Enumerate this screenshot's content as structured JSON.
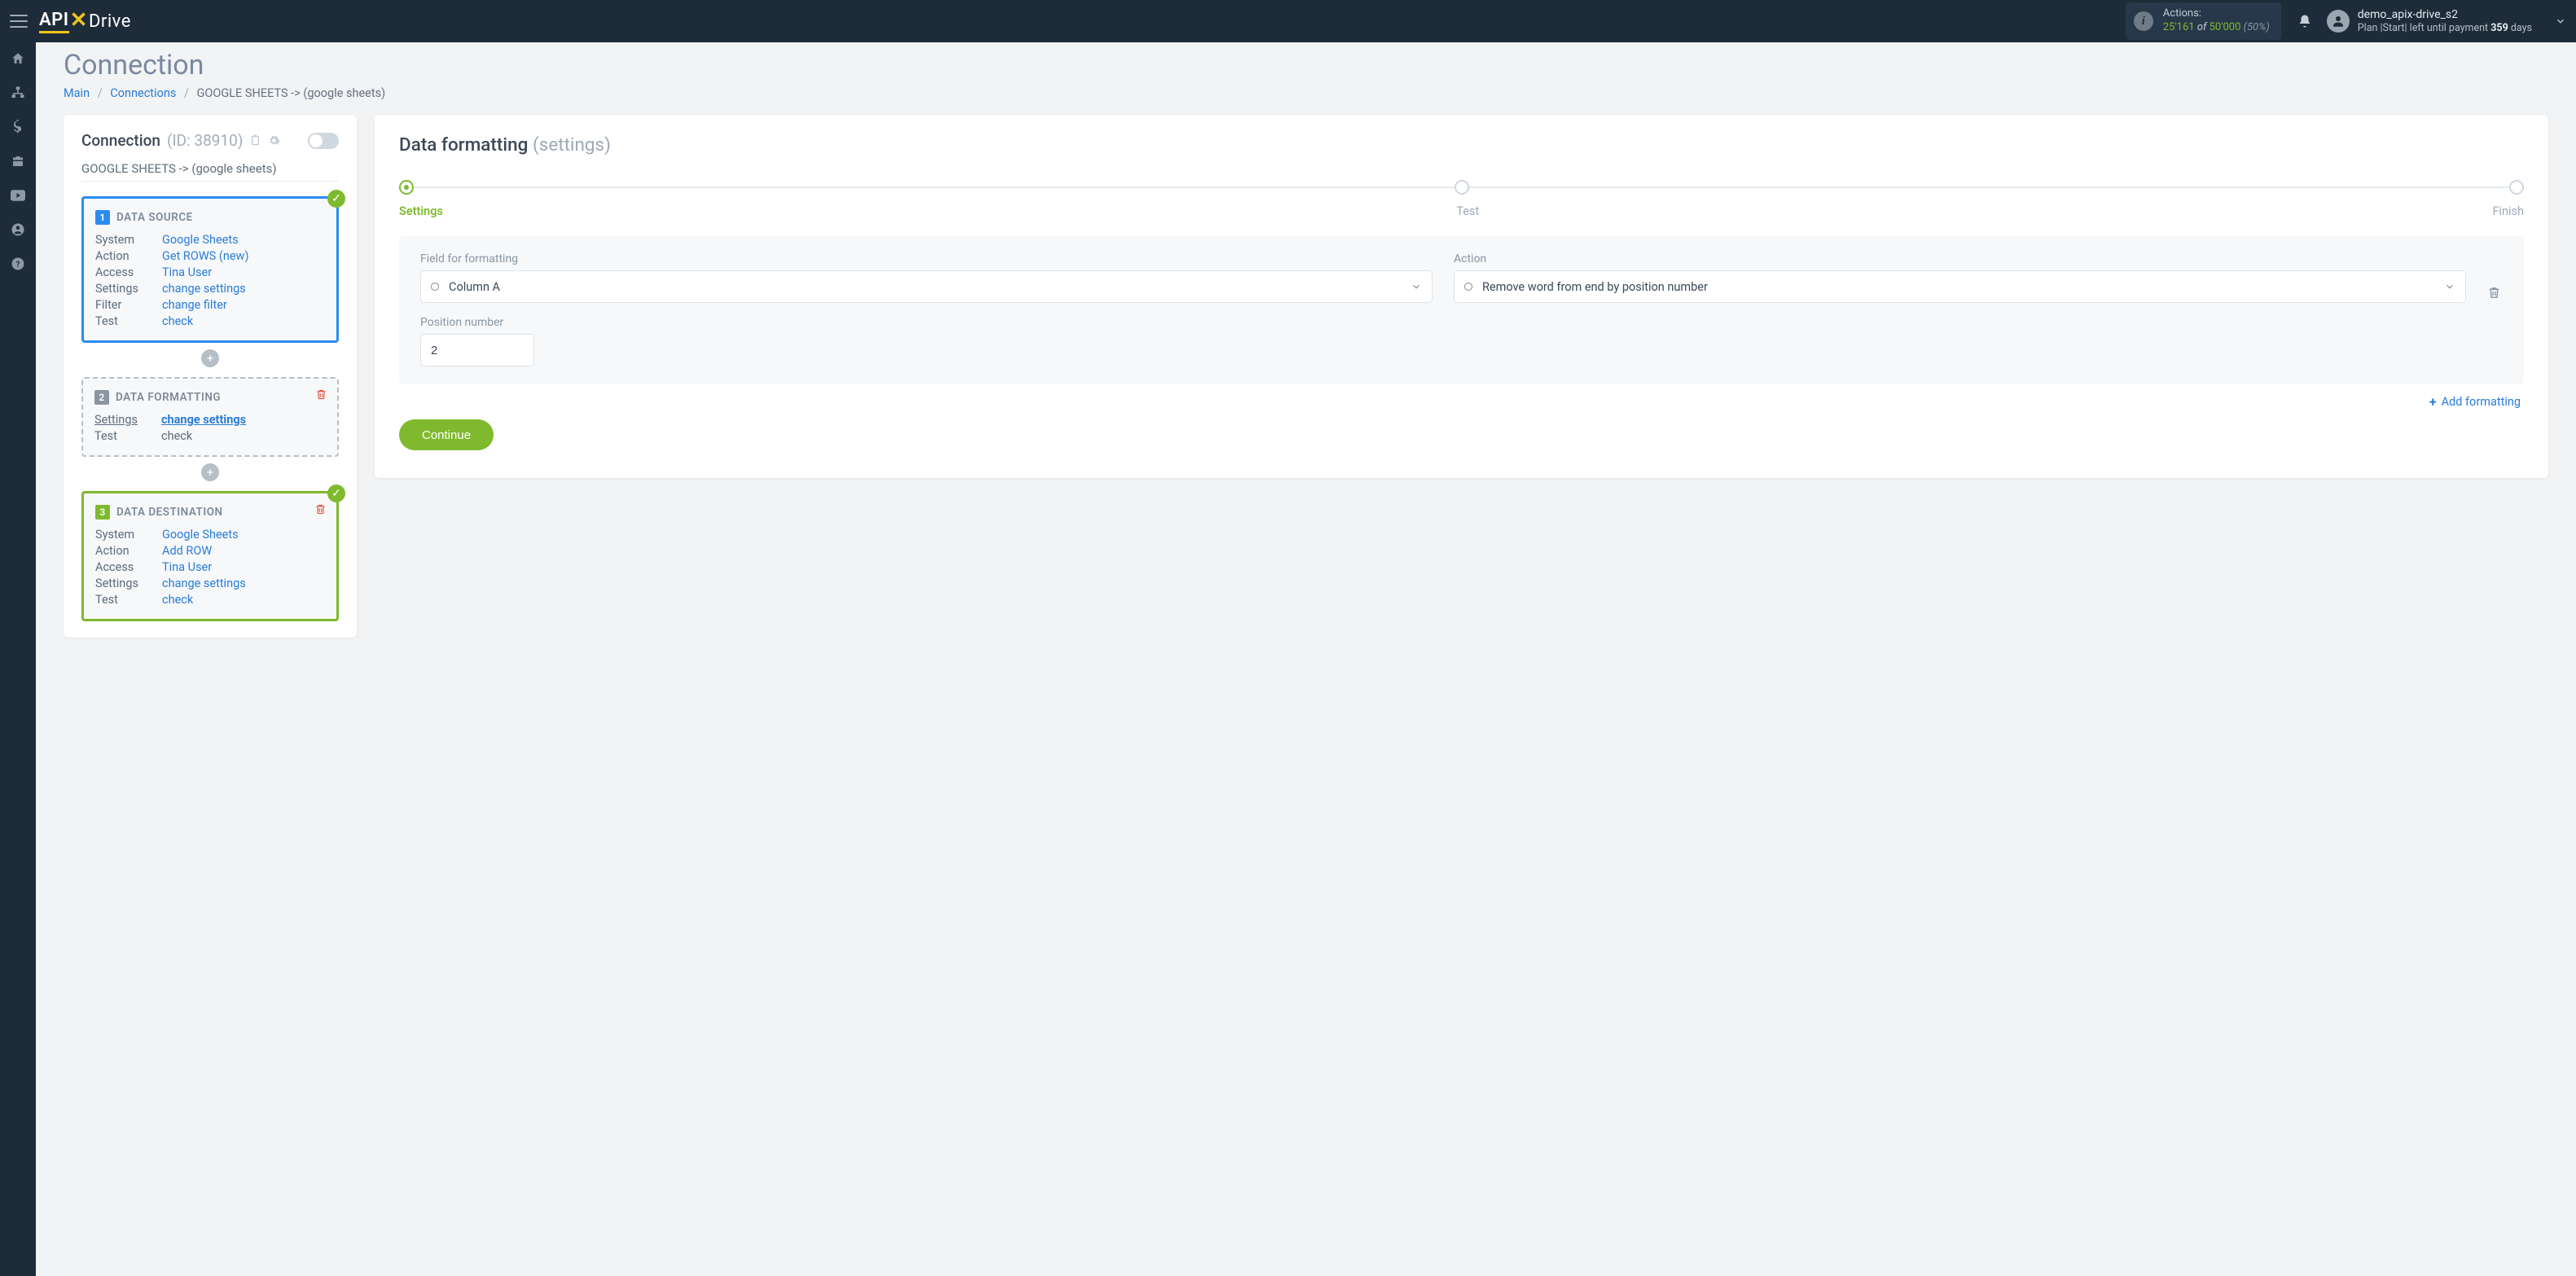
{
  "header": {
    "logo_api": "API",
    "logo_drive": "Drive",
    "actions_label": "Actions:",
    "actions_used": "25'161",
    "actions_of": "of",
    "actions_total": "50'000",
    "actions_pct": "(50%)",
    "username": "demo_apix-drive_s2",
    "plan_prefix": "Plan |Start| left until payment ",
    "plan_days": "359",
    "plan_suffix": " days"
  },
  "page": {
    "title": "Connection",
    "crumb_main": "Main",
    "crumb_connections": "Connections",
    "crumb_current": "GOOGLE SHEETS -> (google sheets)"
  },
  "left": {
    "panel_title": "Connection",
    "panel_id": "(ID: 38910)",
    "sub": "GOOGLE SHEETS -> (google sheets)",
    "source": {
      "title": "DATA SOURCE",
      "num": "1",
      "rows": [
        {
          "k": "System",
          "v": "Google Sheets"
        },
        {
          "k": "Action",
          "v": "Get ROWS (new)"
        },
        {
          "k": "Access",
          "v": "Tina User"
        },
        {
          "k": "Settings",
          "v": "change settings"
        },
        {
          "k": "Filter",
          "v": "change filter"
        },
        {
          "k": "Test",
          "v": "check"
        }
      ]
    },
    "formatting": {
      "title": "DATA FORMATTING",
      "num": "2",
      "rows": [
        {
          "k": "Settings",
          "v": "change settings",
          "active": true
        },
        {
          "k": "Test",
          "v": "check",
          "plain": true
        }
      ]
    },
    "destination": {
      "title": "DATA DESTINATION",
      "num": "3",
      "rows": [
        {
          "k": "System",
          "v": "Google Sheets"
        },
        {
          "k": "Action",
          "v": "Add ROW"
        },
        {
          "k": "Access",
          "v": "Tina User"
        },
        {
          "k": "Settings",
          "v": "change settings"
        },
        {
          "k": "Test",
          "v": "check"
        }
      ]
    }
  },
  "right": {
    "title": "Data formatting",
    "title_muted": "(settings)",
    "steps": [
      "Settings",
      "Test",
      "Finish"
    ],
    "field_label": "Field for formatting",
    "field_value": "Column A",
    "action_label": "Action",
    "action_value": "Remove word from end by position number",
    "pos_label": "Position number",
    "pos_value": "2",
    "add_fmt": "Add formatting",
    "continue": "Continue"
  }
}
